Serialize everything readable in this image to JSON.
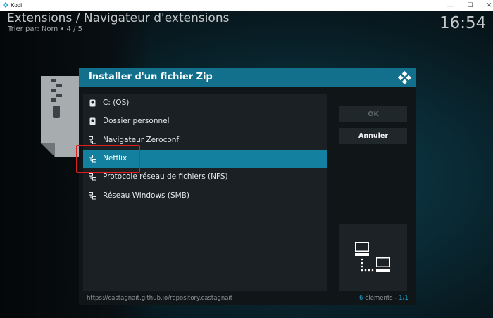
{
  "window": {
    "title": "Kodi",
    "app_icon": "kodi-logo-icon",
    "controls": {
      "minimize": "—",
      "maximize": "☐",
      "close": "✕"
    }
  },
  "header": {
    "title": "Extensions / Navigateur d'extensions",
    "subtitle": "Trier par: Nom  •  4 / 5",
    "clock": "16:54"
  },
  "dialog": {
    "title": "Installer d'un fichier Zip",
    "logo_icon": "kodi-logo-icon",
    "items": [
      {
        "label": "C: (OS)",
        "icon": "drive-icon",
        "selected": false
      },
      {
        "label": "Dossier personnel",
        "icon": "home-drive-icon",
        "selected": false
      },
      {
        "label": "Navigateur Zeroconf",
        "icon": "network-icon",
        "selected": false
      },
      {
        "label": "Netflix",
        "icon": "network-icon",
        "selected": true
      },
      {
        "label": "Protocole réseau de fichiers (NFS)",
        "icon": "network-icon",
        "selected": false
      },
      {
        "label": "Réseau Windows (SMB)",
        "icon": "network-icon",
        "selected": false
      }
    ],
    "buttons": {
      "ok": "OK",
      "cancel": "Annuler"
    },
    "preview_icon": "network-computers-icon",
    "footer": {
      "path": "https://castagnait.github.io/repository.castagnait",
      "count_number": "6",
      "count_label": " éléments - ",
      "page": "1/1"
    }
  },
  "colors": {
    "accent": "#13708d",
    "selection": "#12809e",
    "highlight": "#e01d1d"
  }
}
